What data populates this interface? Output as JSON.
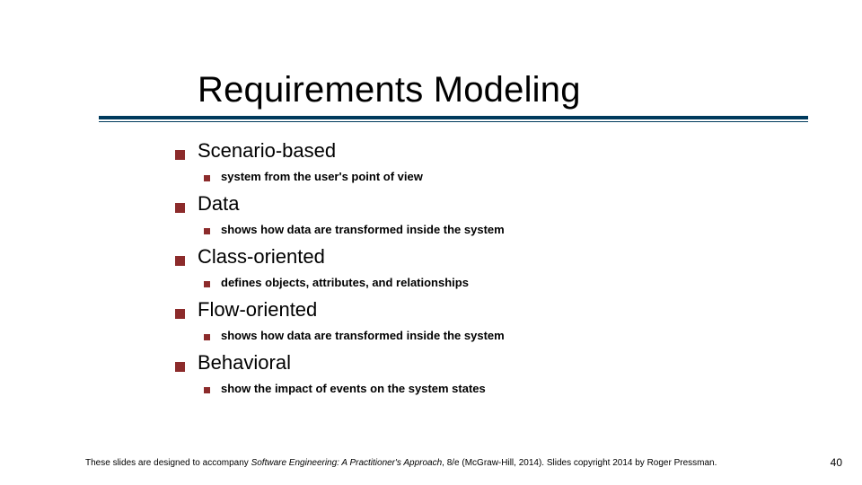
{
  "title": "Requirements Modeling",
  "items": [
    {
      "label": "Scenario-based",
      "sub": "system from the user's point of view"
    },
    {
      "label": "Data",
      "sub": "shows how data are transformed inside the system"
    },
    {
      "label": "Class-oriented",
      "sub": "defines objects, attributes, and relationships"
    },
    {
      "label": "Flow-oriented",
      "sub": "shows how data are transformed inside the system"
    },
    {
      "label": "Behavioral",
      "sub": "show the impact of events on the system states"
    }
  ],
  "footer": {
    "pre": "These slides are designed to accompany ",
    "italic": "Software Engineering: A Practitioner's Approach",
    "post": ", 8/e (McGraw-Hill, 2014). Slides copyright 2014 by Roger Pressman."
  },
  "page_number": "40"
}
